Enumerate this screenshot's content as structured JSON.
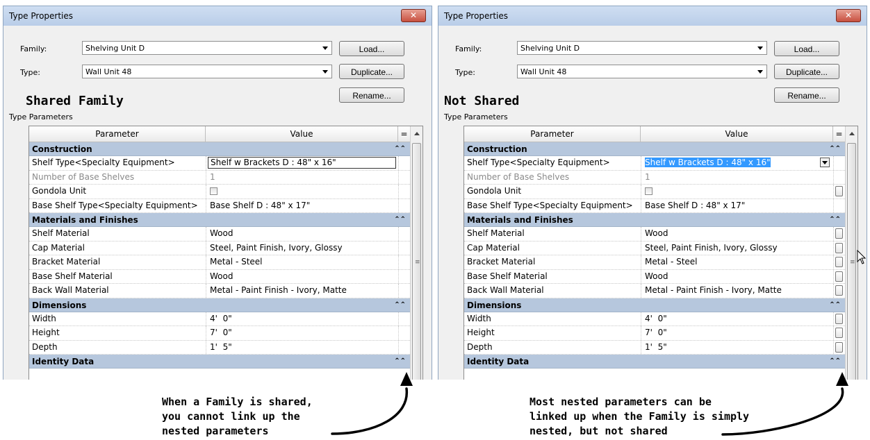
{
  "left_dialog": {
    "title": "Type Properties",
    "close_label": "✕",
    "family_label": "Family:",
    "family_value": "Shelving Unit D",
    "type_label": "Type:",
    "type_value": "Wall Unit 48",
    "load_label": "Load...",
    "duplicate_label": "Duplicate...",
    "rename_label": "Rename...",
    "big_label": "Shared Family",
    "type_parameters_label": "Type Parameters",
    "col_parameter": "Parameter",
    "col_value": "Value",
    "col_eq": "=",
    "groups": {
      "construction": "Construction",
      "materials": "Materials and Finishes",
      "dimensions": "Dimensions",
      "identity": "Identity Data"
    },
    "rows": {
      "shelf_type": {
        "name": "Shelf Type<Specialty Equipment>",
        "value": "Shelf w Brackets D : 48\" x 16\""
      },
      "base_shelves": {
        "name": "Number of Base Shelves",
        "value": "1"
      },
      "gondola": {
        "name": "Gondola Unit"
      },
      "base_shelf_type": {
        "name": "Base Shelf Type<Specialty Equipment>",
        "value": "Base Shelf D : 48\" x 17\""
      },
      "shelf_material": {
        "name": "Shelf Material",
        "value": "Wood"
      },
      "cap_material": {
        "name": "Cap Material",
        "value": "Steel, Paint Finish, Ivory, Glossy"
      },
      "bracket_material": {
        "name": "Bracket Material",
        "value": "Metal - Steel"
      },
      "base_shelf_material": {
        "name": "Base Shelf Material",
        "value": "Wood"
      },
      "back_wall_material": {
        "name": "Back Wall Material",
        "value": "Metal - Paint Finish - Ivory, Matte"
      },
      "width": {
        "name": "Width",
        "value": "4'  0\""
      },
      "height": {
        "name": "Height",
        "value": "7'  0\""
      },
      "depth": {
        "name": "Depth",
        "value": "1'  5\""
      }
    }
  },
  "right_dialog": {
    "title": "Type Properties",
    "close_label": "✕",
    "family_label": "Family:",
    "family_value": "Shelving Unit D",
    "type_label": "Type:",
    "type_value": "Wall Unit 48",
    "load_label": "Load...",
    "duplicate_label": "Duplicate...",
    "rename_label": "Rename...",
    "big_label": "Not Shared",
    "type_parameters_label": "Type Parameters",
    "col_parameter": "Parameter",
    "col_value": "Value",
    "col_eq": "=",
    "groups": {
      "construction": "Construction",
      "materials": "Materials and Finishes",
      "dimensions": "Dimensions",
      "identity": "Identity Data"
    },
    "rows": {
      "shelf_type": {
        "name": "Shelf Type<Specialty Equipment>",
        "value": "Shelf w Brackets D : 48\" x 16\""
      },
      "base_shelves": {
        "name": "Number of Base Shelves",
        "value": "1"
      },
      "gondola": {
        "name": "Gondola Unit"
      },
      "base_shelf_type": {
        "name": "Base Shelf Type<Specialty Equipment>",
        "value": "Base Shelf D : 48\" x 17\""
      },
      "shelf_material": {
        "name": "Shelf Material",
        "value": "Wood"
      },
      "cap_material": {
        "name": "Cap Material",
        "value": "Steel, Paint Finish, Ivory, Glossy"
      },
      "bracket_material": {
        "name": "Bracket Material",
        "value": "Metal - Steel"
      },
      "base_shelf_material": {
        "name": "Base Shelf Material",
        "value": "Wood"
      },
      "back_wall_material": {
        "name": "Back Wall Material",
        "value": "Metal - Paint Finish - Ivory, Matte"
      },
      "width": {
        "name": "Width",
        "value": "4'  0\""
      },
      "height": {
        "name": "Height",
        "value": "7'  0\""
      },
      "depth": {
        "name": "Depth",
        "value": "1'  5\""
      }
    }
  },
  "annotations": {
    "left": "When a Family is shared,\nyou cannot link up the\nnested parameters",
    "right": "Most nested parameters can be\nlinked up when the Family is simply\nnested, but not shared"
  },
  "colors": {
    "title_bar": "#cfdef2",
    "group_header": "#b6c7dd",
    "selection": "#3399ff",
    "close_button": "#c75040"
  }
}
